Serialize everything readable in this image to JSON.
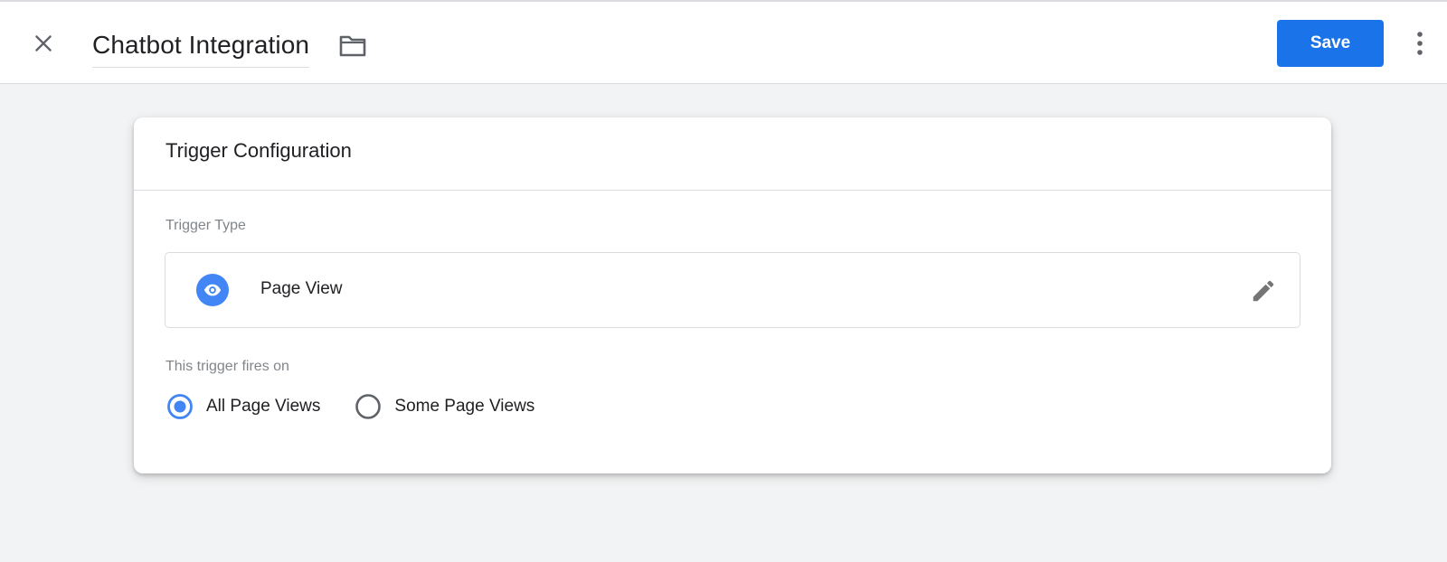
{
  "header": {
    "title": "Chatbot Integration",
    "save_label": "Save",
    "close_icon": "close-icon",
    "folder_icon": "folder-icon",
    "more_icon": "more-vert-icon"
  },
  "card": {
    "title": "Trigger Configuration",
    "trigger_type_label": "Trigger Type",
    "trigger_type": {
      "name": "Page View",
      "icon": "eye-icon",
      "edit_icon": "pencil-icon"
    },
    "fires_on_label": "This trigger fires on",
    "fires_on_options": [
      {
        "label": "All Page Views",
        "selected": true
      },
      {
        "label": "Some Page Views",
        "selected": false
      }
    ]
  },
  "colors": {
    "accent": "#1a73e8",
    "icon_blue": "#4285f4",
    "background": "#f1f3f4"
  }
}
